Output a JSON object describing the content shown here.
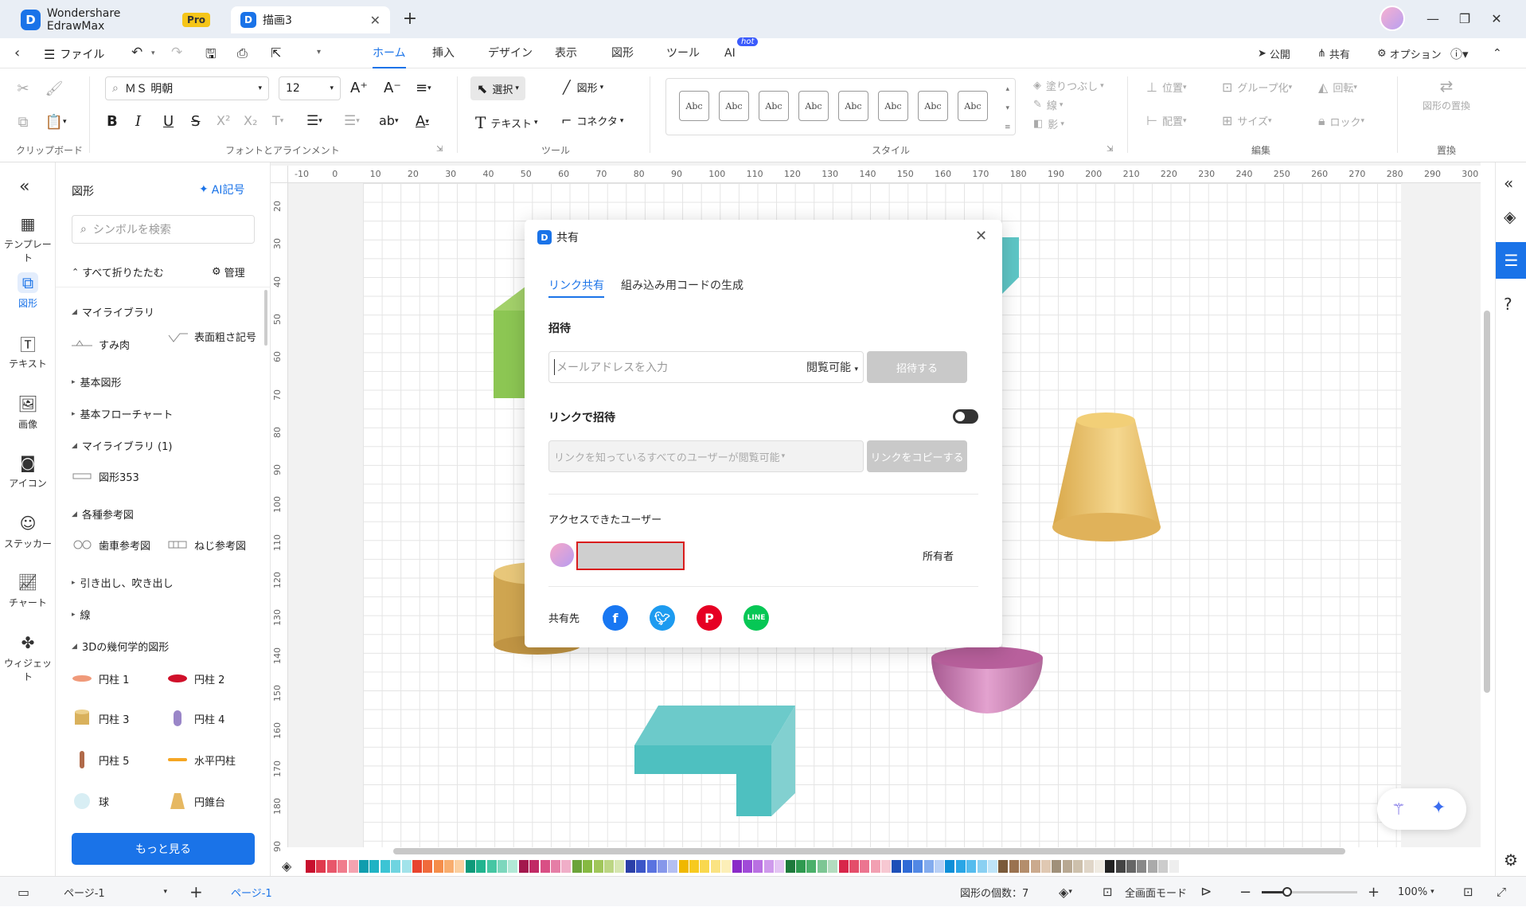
{
  "app": {
    "name": "Wondershare EdrawMax",
    "badge": "Pro",
    "doc_tab": "描画3"
  },
  "menu": {
    "file": "ファイル",
    "tabs": [
      "ホーム",
      "挿入",
      "デザイン",
      "表示",
      "図形",
      "ツール",
      "AI"
    ],
    "ai_badge": "hot",
    "publish": "公開",
    "share": "共有",
    "options": "オプション"
  },
  "ribbon": {
    "font_name": "ＭＳ 明朝",
    "font_size": "12",
    "select": "選択",
    "shape": "図形",
    "text": "テキスト",
    "connector": "コネクタ",
    "style_sample": "Abc",
    "fill": "塗りつぶし",
    "line": "線",
    "shadow": "影",
    "position": "位置",
    "group": "グループ化",
    "rotate": "回転",
    "align": "配置",
    "size": "サイズ",
    "lock": "ロック",
    "replace_shape": "図形の置換",
    "groups": [
      "クリップボード",
      "フォントとアラインメント",
      "ツール",
      "スタイル",
      "編集",
      "置換"
    ]
  },
  "leftrail": [
    "テンプレート",
    "図形",
    "テキスト",
    "画像",
    "アイコン",
    "ステッカー",
    "チャート",
    "ウィジェット"
  ],
  "panel": {
    "title": "図形",
    "ai_symbol": "AI記号",
    "search_placeholder": "シンボルを検索",
    "collapse_all": "すべて折りたたむ",
    "manage": "管理",
    "more": "もっと見る",
    "categories": {
      "my_library": "マイライブラリ",
      "basic_shapes": "基本図形",
      "basic_flowchart": "基本フローチャート",
      "my_library_1": "マイライブラリ (1)",
      "reference": "各種参考図",
      "callout": "引き出し、吹き出し",
      "line": "線",
      "geo3d": "3Dの幾何学的図形"
    },
    "items": {
      "sumi_niku": "すみ肉",
      "surface_rough": "表面粗さ記号",
      "shape353": "図形353",
      "gear_ref": "歯車参考図",
      "screw_ref": "ねじ参考図",
      "cyl1": "円柱 1",
      "cyl2": "円柱 2",
      "cyl3": "円柱 3",
      "cyl4": "円柱 4",
      "cyl5": "円柱 5",
      "hcyl": "水平円柱",
      "sphere": "球",
      "cone": "円錐台"
    }
  },
  "ruler": {
    "top": [
      "-10",
      "0",
      "10",
      "20",
      "30",
      "40",
      "50",
      "60",
      "70",
      "80",
      "90",
      "100",
      "110",
      "120",
      "130",
      "140",
      "150",
      "160",
      "170",
      "180",
      "190",
      "200",
      "210",
      "220",
      "230",
      "240",
      "250",
      "260",
      "270",
      "280",
      "290",
      "300"
    ],
    "left": [
      "20",
      "30",
      "40",
      "50",
      "60",
      "70",
      "80",
      "90",
      "100",
      "110",
      "120",
      "130",
      "140",
      "150",
      "160",
      "170",
      "180",
      "90"
    ]
  },
  "dialog": {
    "title": "共有",
    "tab_link": "リンク共有",
    "tab_embed": "組み込み用コードの生成",
    "invite": "招待",
    "email_placeholder": "メールアドレスを入力",
    "permission": "閲覧可能",
    "invite_btn": "招待する",
    "link_invite": "リンクで招待",
    "link_permission": "リンクを知っているすべてのユーザーが閲覧可能",
    "copy_link": "リンクをコピーする",
    "access_users": "アクセスできたユーザー",
    "owner": "所有者",
    "share_to": "共有先"
  },
  "status": {
    "page_select": "ページ-1",
    "page_tab": "ページ-1",
    "shape_count": "図形の個数：7",
    "fullscreen": "全画面モード",
    "zoom": "100%"
  },
  "colors": {
    "accent": "#1a73e8",
    "palette": [
      "#c8102e",
      "#e03a4e",
      "#e8576b",
      "#f07c8c",
      "#f4a3b0",
      "#0f9dae",
      "#20b3c4",
      "#3cc4d4",
      "#6fd4e0",
      "#a2e3ea",
      "#e8442e",
      "#f06a3c",
      "#f58d4a",
      "#f8ad6e",
      "#fbcfa0",
      "#0e9a7a",
      "#22b48f",
      "#46c6a3",
      "#7dd7bd",
      "#b1e8d6",
      "#a3174d",
      "#c12a65",
      "#d94f85",
      "#e57ea6",
      "#f0aec8",
      "#6ba33a",
      "#86b942",
      "#a0c65a",
      "#bcd684",
      "#d6e6b0",
      "#2a3fa8",
      "#3c56c8",
      "#5a73e0",
      "#8697ea",
      "#b4bff2",
      "#f0b800",
      "#f7ca1f",
      "#f9d84e",
      "#fae383",
      "#fcefb8",
      "#8a2ac8",
      "#a04ad8",
      "#b970e2",
      "#cf9aec",
      "#e4c4f4",
      "#1e7a3c",
      "#2f9a50",
      "#4bb06a",
      "#7dc694",
      "#b3dcbf",
      "#d8264a",
      "#e44d6a",
      "#ec7590",
      "#f2a0b2",
      "#f7c8d2",
      "#1d4fb8",
      "#2f6ad6",
      "#5288e4",
      "#84acee",
      "#b8d0f6",
      "#0d8fd8",
      "#2aa6e6",
      "#56bcee",
      "#8ad0f2",
      "#bee4f8",
      "#7a5a3a",
      "#9a7250",
      "#b48e6c",
      "#cbaa8e",
      "#e0c8b2",
      "#a0907a",
      "#b8a892",
      "#cdc0ac",
      "#e0d6c8",
      "#f0ebe2",
      "#222222",
      "#444444",
      "#666666",
      "#888888",
      "#aaaaaa",
      "#cccccc",
      "#eeeeee"
    ]
  }
}
